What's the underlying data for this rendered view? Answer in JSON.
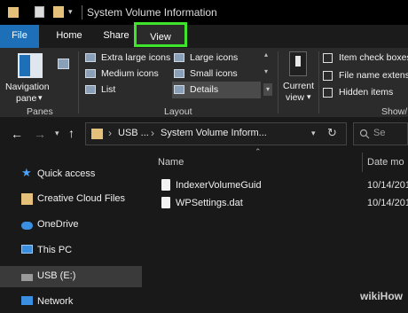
{
  "window": {
    "title": "System Volume Information"
  },
  "ribbon_tabs": [
    {
      "label": "File"
    },
    {
      "label": "Home"
    },
    {
      "label": "Share"
    },
    {
      "label": "View"
    }
  ],
  "ribbon": {
    "navigation_pane": {
      "line1": "Navigation",
      "line2": "pane",
      "arrow": "▾"
    },
    "panes_group": "Panes",
    "layout_group": "Layout",
    "layout_options": [
      {
        "label": "Extra large icons"
      },
      {
        "label": "Large icons"
      },
      {
        "label": "Medium icons"
      },
      {
        "label": "Small icons"
      },
      {
        "label": "List"
      },
      {
        "label": "Details"
      }
    ],
    "current_view": {
      "line1": "Current",
      "line2": "view",
      "arrow": "▾"
    },
    "show_hide_group": "Show/",
    "checkboxes": [
      {
        "label": "Item check boxes"
      },
      {
        "label": "File name extens"
      },
      {
        "label": "Hidden items"
      }
    ]
  },
  "address_bar": {
    "segments": [
      {
        "label": "USB ..."
      },
      {
        "label": "System Volume Inform..."
      }
    ],
    "separator": "›",
    "search_placeholder": "Se"
  },
  "nav_pane": [
    {
      "label": "Quick access",
      "icon": "star-icon"
    },
    {
      "label": "Creative Cloud Files",
      "icon": "creative-cloud-folder-icon"
    },
    {
      "label": "OneDrive",
      "icon": "cloud-icon"
    },
    {
      "label": "This PC",
      "icon": "computer-icon"
    },
    {
      "label": "USB (E:)",
      "icon": "usb-drive-icon"
    },
    {
      "label": "Network",
      "icon": "network-icon"
    }
  ],
  "file_list": {
    "columns": {
      "name": "Name",
      "date": "Date mo"
    },
    "files": [
      {
        "name": "IndexerVolumeGuid",
        "date": "10/14/201"
      },
      {
        "name": "WPSettings.dat",
        "date": "10/14/201"
      }
    ]
  },
  "watermark": {
    "brand": "wikiHow"
  },
  "colors": {
    "highlight": "#3fe52b",
    "file_tab": "#1d6fb8",
    "background": "#191919"
  }
}
